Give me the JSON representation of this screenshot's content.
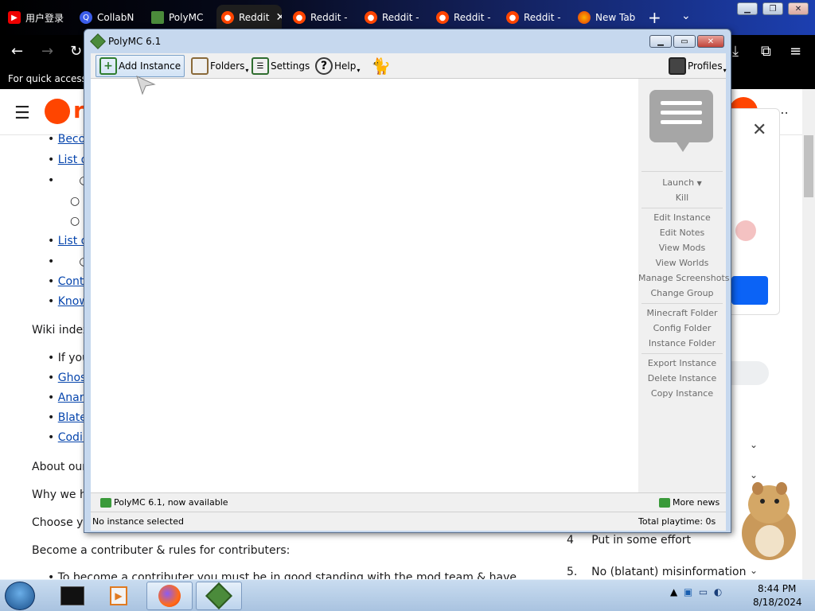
{
  "browser": {
    "tabs": [
      {
        "label": "用户登录",
        "fav": "youtube"
      },
      {
        "label": "CollabN",
        "fav": "search"
      },
      {
        "label": "PolyMC",
        "fav": "polymc"
      },
      {
        "label": "Reddit",
        "fav": "reddit",
        "active": true
      },
      {
        "label": "Reddit -",
        "fav": "reddit"
      },
      {
        "label": "Reddit -",
        "fav": "reddit"
      },
      {
        "label": "Reddit -",
        "fav": "reddit"
      },
      {
        "label": "Reddit -",
        "fav": "reddit"
      },
      {
        "label": "New Tab",
        "fav": "firefox"
      }
    ],
    "bookmarks_text": "For quick access, p"
  },
  "page": {
    "logo_text": "r",
    "wiki_list1": [
      "Becor",
      "List o"
    ],
    "wiki_list2": [
      "List o"
    ],
    "wiki_list3": [
      "Contr",
      "Know"
    ],
    "wiki_index": "Wiki index",
    "wiki_list4": [
      "If you",
      "Ghos",
      "Anarc",
      "Blate",
      "Codir"
    ],
    "about": "About our",
    "why": "Why we ha",
    "choose": "Choose yo",
    "contrib_heading": "Become a contributer & rules for contributers:",
    "contrib_bullet": "To become a contributer you must be in good standing with the mod team & have",
    "rules": [
      {
        "num": "4",
        "text": "Put in some effort"
      },
      {
        "num": "5.",
        "text": "No (blatant) misinformation"
      }
    ]
  },
  "polymc": {
    "title": "PolyMC 6.1",
    "toolbar": {
      "add_instance": "Add Instance",
      "folders": "Folders",
      "settings": "Settings",
      "help": "Help",
      "profiles": "Profiles"
    },
    "sidebar": {
      "launch": "Launch",
      "kill": "Kill",
      "edit_instance": "Edit Instance",
      "edit_notes": "Edit Notes",
      "view_mods": "View Mods",
      "view_worlds": "View Worlds",
      "manage_screenshots": "Manage Screenshots",
      "change_group": "Change Group",
      "minecraft_folder": "Minecraft Folder",
      "config_folder": "Config Folder",
      "instance_folder": "Instance Folder",
      "export_instance": "Export Instance",
      "delete_instance": "Delete Instance",
      "copy_instance": "Copy Instance"
    },
    "news_text": "PolyMC 6.1, now available",
    "more_news": "More news",
    "status_left": "No instance selected",
    "status_right": "Total playtime: 0s"
  },
  "taskbar": {
    "time": "8:44 PM",
    "date": "8/18/2024"
  },
  "colors": {
    "accent_reddit": "#ff4500",
    "link": "#0645ad",
    "polymc_frame": "#c6d8ee"
  }
}
